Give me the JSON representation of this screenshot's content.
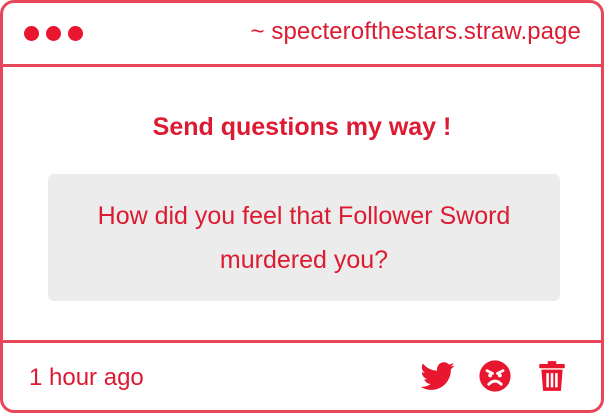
{
  "window": {
    "url": "~ specterofthestars.straw.page"
  },
  "main": {
    "heading": "Send questions my way !",
    "question": "How did you feel that Follower Sword murdered you?"
  },
  "footer": {
    "timestamp": "1 hour ago",
    "actions": [
      {
        "icon": "twitter-icon"
      },
      {
        "icon": "angry-face-icon"
      },
      {
        "icon": "trash-icon"
      }
    ]
  },
  "colors": {
    "accent": "#dc1a31",
    "border": "#e8465a",
    "question_bg": "#ececec"
  }
}
